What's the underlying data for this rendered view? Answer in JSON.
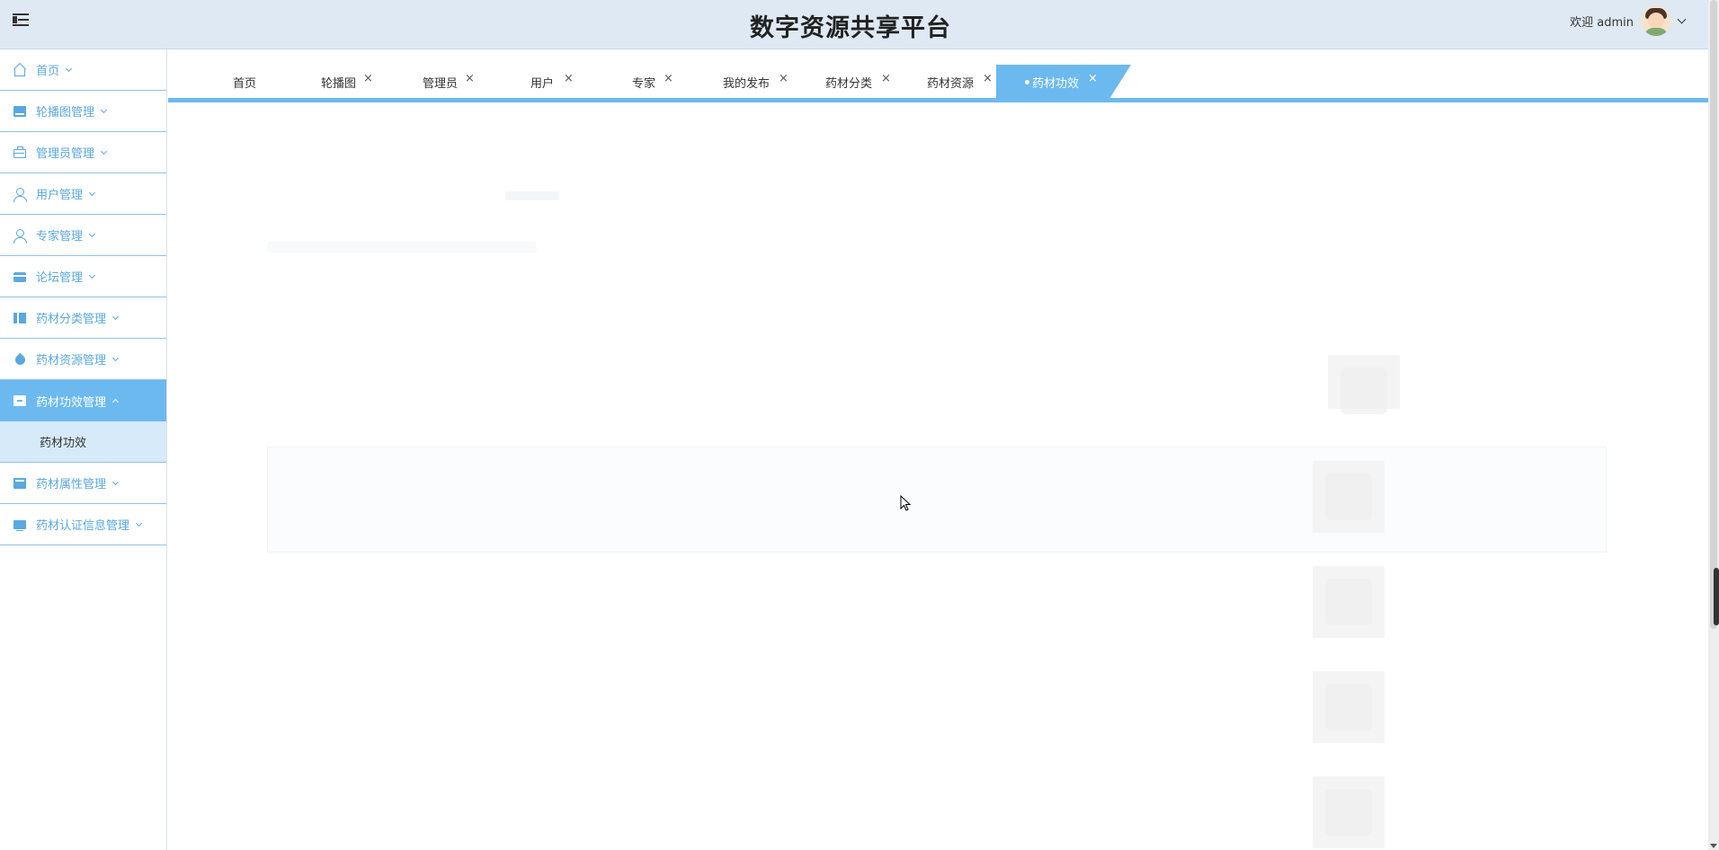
{
  "header": {
    "title": "数字资源共享平台",
    "welcome": "欢迎 admin",
    "menu_toggle": "menu-toggle-icon",
    "avatar": "avatar"
  },
  "sidebar": {
    "items": [
      {
        "label": "首页",
        "icon": "home-icon"
      },
      {
        "label": "轮播图管理",
        "icon": "image-icon"
      },
      {
        "label": "管理员管理",
        "icon": "briefcase-icon"
      },
      {
        "label": "用户管理",
        "icon": "user-icon"
      },
      {
        "label": "专家管理",
        "icon": "user-icon"
      },
      {
        "label": "论坛管理",
        "icon": "card-icon"
      },
      {
        "label": "药材分类管理",
        "icon": "book-icon"
      },
      {
        "label": "药材资源管理",
        "icon": "drop-icon"
      },
      {
        "label": "药材功效管理",
        "icon": "box-icon",
        "active": true,
        "children": [
          "药材功效"
        ]
      },
      {
        "label": "药材属性管理",
        "icon": "tab-icon"
      },
      {
        "label": "药材认证信息管理",
        "icon": "monitor-icon"
      }
    ]
  },
  "tabs": [
    {
      "label": "首页",
      "closable": false
    },
    {
      "label": "轮播图",
      "closable": true
    },
    {
      "label": "管理员",
      "closable": true
    },
    {
      "label": "用户",
      "closable": true
    },
    {
      "label": "专家",
      "closable": true
    },
    {
      "label": "我的发布",
      "closable": true
    },
    {
      "label": "药材分类",
      "closable": true
    },
    {
      "label": "药材资源",
      "closable": true
    },
    {
      "label": "药材功效",
      "closable": true,
      "active": true
    }
  ],
  "glyphs": {
    "close": "×"
  },
  "colors": {
    "accent": "#6cb9ef",
    "nav_text": "#5aa8e0",
    "header_bg": "#dfe9f3",
    "submenu_bg": "#d6eaf9"
  }
}
